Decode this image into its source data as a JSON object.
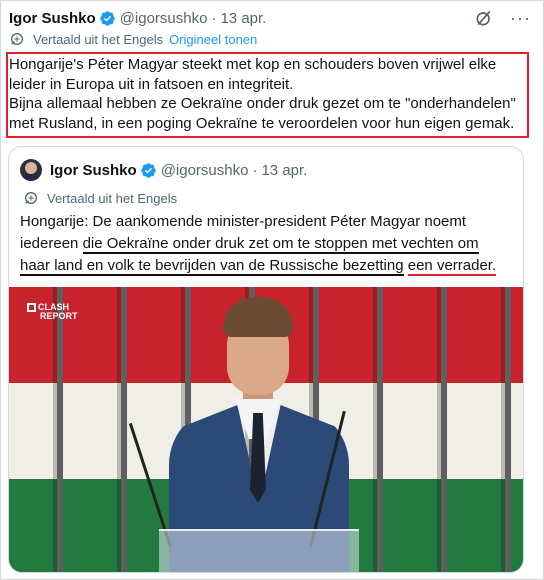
{
  "tweet": {
    "author_name": "Igor Sushko",
    "handle": "@igorsushko",
    "separator": "·",
    "date": "13 apr.",
    "more_label": "···",
    "translated_label": "Vertaald uit het Engels",
    "original_link": "Origineel tonen",
    "text_lines": [
      "Hongarije's Péter Magyar steekt met kop en schouders boven vrijwel elke",
      "leider in Europa uit in fatsoen en integriteit.",
      "Bijna allemaal hebben ze Oekraïne onder druk gezet om te \"onderhandelen\"",
      "met Rusland, in een poging Oekraïne te veroordelen voor hun eigen gemak."
    ]
  },
  "quote": {
    "author_name": "Igor Sushko",
    "handle": "@igorsushko",
    "separator": "·",
    "date": "13 apr.",
    "translated_label": "Vertaald uit het Engels",
    "line1": "Hongarije: De aankomende minister-president Péter Magyar noemt",
    "line2_plain": "iedereen ",
    "line2_underlined": "die Oekraïne onder druk zet om te stoppen met vechten om",
    "line3_underlined": "haar land en volk te bevrijden van de Russische bezetting",
    "line3_space": " ",
    "line3_red": "een verrader.",
    "media_logo_top": "CLASH",
    "media_logo_bottom": "REPORT"
  },
  "colors": {
    "accent": "#1d9bf0",
    "highlight_box": "#e0202a",
    "underline_black": "#111111",
    "underline_red": "#e0202a",
    "flag_red": "#c8222d",
    "flag_white": "#efefe8",
    "flag_green": "#237a3e"
  },
  "icons": {
    "verified": "verified-badge-icon",
    "grok": "grok-icon",
    "more": "more-options-icon",
    "translate": "translate-globe-icon"
  }
}
